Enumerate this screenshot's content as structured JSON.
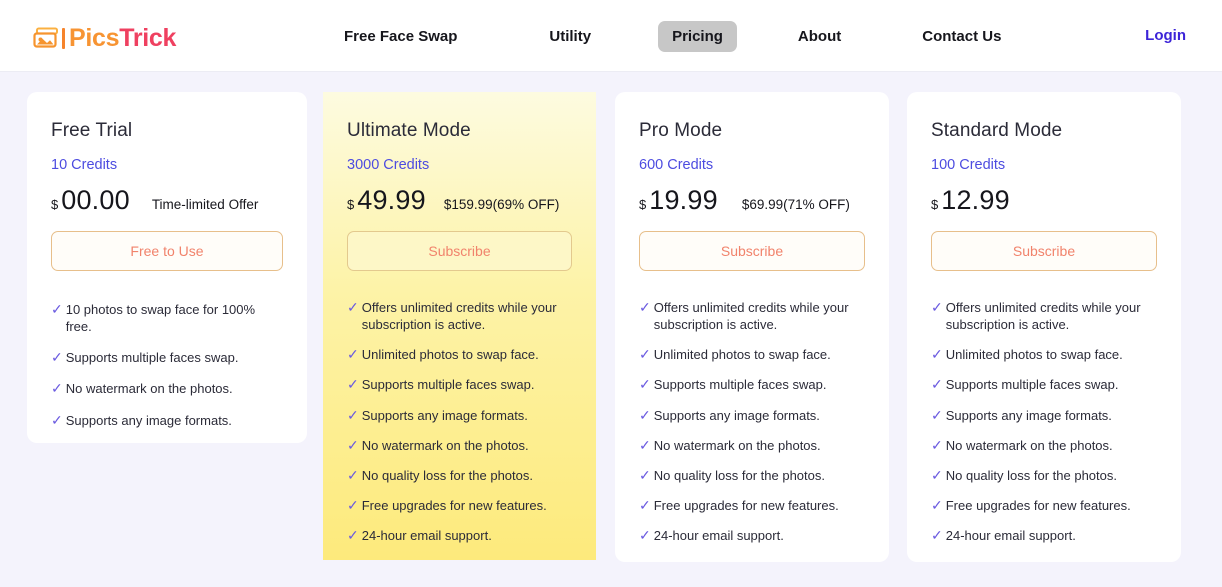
{
  "header": {
    "logo": {
      "icon": "photo-stack-icon",
      "text_primary": "Pics",
      "text_secondary": "Trick"
    },
    "nav": [
      {
        "label": "Free Face Swap",
        "active": false
      },
      {
        "label": "Utility",
        "active": false
      },
      {
        "label": "Pricing",
        "active": true
      },
      {
        "label": "About",
        "active": false
      },
      {
        "label": "Contact Us",
        "active": false
      }
    ],
    "login_label": "Login",
    "colors": {
      "logo_primary": "#f79433",
      "logo_secondary": "#ef4060",
      "login": "#3c24d8",
      "active_nav_bg": "#c7c7c7"
    }
  },
  "plans": [
    {
      "title": "Free Trial",
      "credits": "10 Credits",
      "currency": "$",
      "price": "00.00",
      "price_note": "Time-limited Offer",
      "cta": "Free to Use",
      "highlighted": false,
      "features": [
        "10 photos to swap face for 100% free.",
        "Supports multiple faces swap.",
        "No watermark on the photos.",
        "Supports any image formats."
      ]
    },
    {
      "title": "Ultimate Mode",
      "credits": "3000 Credits",
      "currency": "$",
      "price": "49.99",
      "price_note": "$159.99(69% OFF)",
      "cta": "Subscribe",
      "highlighted": true,
      "features": [
        "Offers unlimited credits while your subscription is active.",
        "Unlimited photos to swap face.",
        "Supports multiple faces swap.",
        "Supports any image formats.",
        "No watermark on the photos.",
        "No quality loss for the photos.",
        "Free upgrades for new features.",
        "24-hour email support."
      ]
    },
    {
      "title": "Pro Mode",
      "credits": "600 Credits",
      "currency": "$",
      "price": "19.99",
      "price_note": "$69.99(71% OFF)",
      "cta": "Subscribe",
      "highlighted": false,
      "features": [
        "Offers unlimited credits while your subscription is active.",
        "Unlimited photos to swap face.",
        "Supports multiple faces swap.",
        "Supports any image formats.",
        "No watermark on the photos.",
        "No quality loss for the photos.",
        "Free upgrades for new features.",
        "24-hour email support."
      ]
    },
    {
      "title": "Standard Mode",
      "credits": "100 Credits",
      "currency": "$",
      "price": "12.99",
      "price_note": "",
      "cta": "Subscribe",
      "highlighted": false,
      "features": [
        "Offers unlimited credits while your subscription is active.",
        "Unlimited photos to swap face.",
        "Supports multiple faces swap.",
        "Supports any image formats.",
        "No watermark on the photos.",
        "No quality loss for the photos.",
        "Free upgrades for new features.",
        "24-hour email support."
      ]
    }
  ],
  "icons": {
    "check": "✓"
  },
  "theme": {
    "page_bg": "#f4f3fc",
    "card_bg": "#ffffff",
    "highlight_bg": "#fdea7c",
    "credits_color": "#4d4ce0",
    "check_color": "#6a5ae0",
    "cta_text": "#f1836c",
    "cta_border": "#e7bf8b"
  }
}
